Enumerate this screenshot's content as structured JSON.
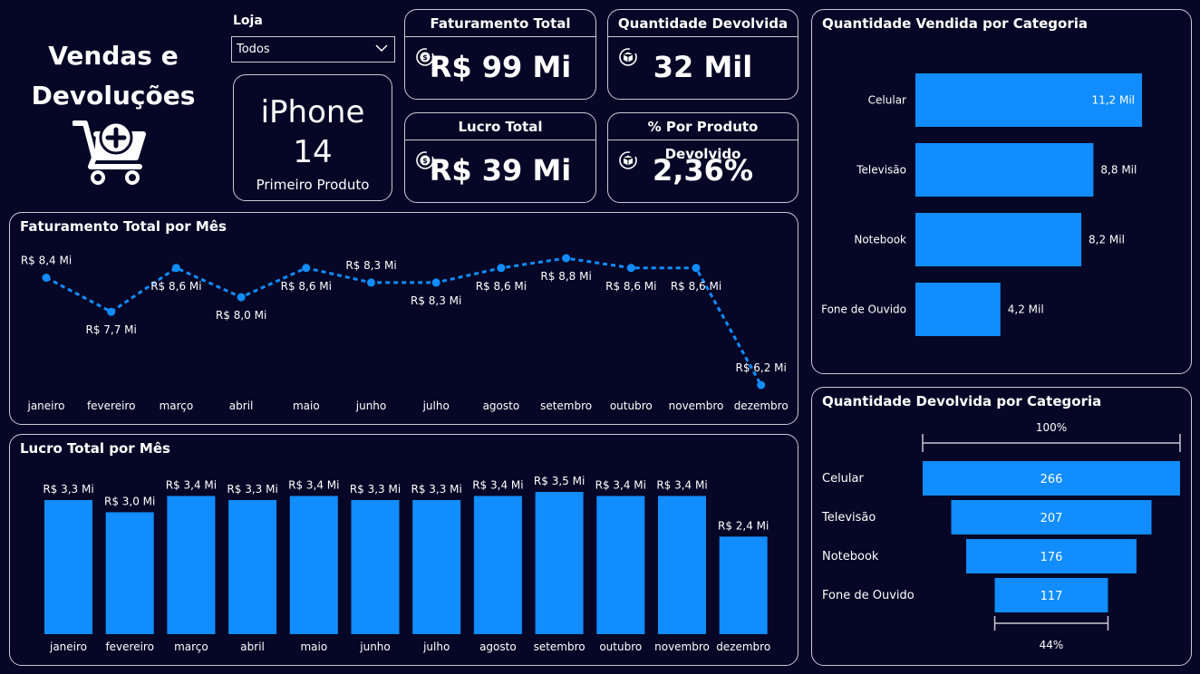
{
  "header": {
    "title_line1": "Vendas e",
    "title_line2": "Devoluções"
  },
  "filter": {
    "label": "Loja",
    "selected": "Todos"
  },
  "product_card": {
    "line1": "iPhone",
    "line2": "14",
    "caption": "Primeiro Produto"
  },
  "kpis": {
    "faturamento": {
      "title": "Faturamento Total",
      "value": "R$ 99 Mi"
    },
    "devolvida": {
      "title": "Quantidade Devolvida",
      "value": "32 Mil"
    },
    "lucro": {
      "title": "Lucro Total",
      "value": "R$ 39 Mi"
    },
    "pct": {
      "title": "% Por Produto Devolvido",
      "value": "2,36%"
    }
  },
  "colors": {
    "background": "#060626",
    "accent": "#118dff",
    "border": "#c9c9d6",
    "text": "#ffffff"
  },
  "icons": {
    "cart": "shopping-cart-plus-icon",
    "money": "money-cycle-icon",
    "box": "box-return-icon",
    "dropdown": "chevron-down-icon"
  },
  "chart_data": [
    {
      "id": "faturamento_mes",
      "type": "line",
      "title": "Faturamento Total por Mês",
      "categories": [
        "janeiro",
        "fevereiro",
        "março",
        "abril",
        "maio",
        "junho",
        "julho",
        "agosto",
        "setembro",
        "outubro",
        "novembro",
        "dezembro"
      ],
      "values": [
        8.4,
        7.7,
        8.6,
        8.0,
        8.6,
        8.3,
        8.3,
        8.6,
        8.8,
        8.6,
        8.6,
        6.2
      ],
      "labels": [
        "R$ 8,4 Mi",
        "R$ 7,7 Mi",
        "R$ 8,6 Mi",
        "R$ 8,0 Mi",
        "R$ 8,6 Mi",
        "R$ 8,3 Mi",
        "R$ 8,3 Mi",
        "R$ 8,6 Mi",
        "R$ 8,8 Mi",
        "R$ 8,6 Mi",
        "R$ 8,6 Mi",
        "R$ 6,2 Mi"
      ],
      "label_pos": [
        "above",
        "below",
        "below",
        "below",
        "below",
        "above",
        "below",
        "below",
        "below",
        "below",
        "below",
        "above"
      ],
      "ylim": [
        6.2,
        8.8
      ],
      "line_style": "dashed"
    },
    {
      "id": "lucro_mes",
      "type": "bar",
      "title": "Lucro Total por Mês",
      "categories": [
        "janeiro",
        "fevereiro",
        "março",
        "abril",
        "maio",
        "junho",
        "julho",
        "agosto",
        "setembro",
        "outubro",
        "novembro",
        "dezembro"
      ],
      "values": [
        3.3,
        3.0,
        3.4,
        3.3,
        3.4,
        3.3,
        3.3,
        3.4,
        3.5,
        3.4,
        3.4,
        2.4
      ],
      "labels": [
        "R$ 3,3 Mi",
        "R$ 3,0 Mi",
        "R$ 3,4 Mi",
        "R$ 3,3 Mi",
        "R$ 3,4 Mi",
        "R$ 3,3 Mi",
        "R$ 3,3 Mi",
        "R$ 3,4 Mi",
        "R$ 3,5 Mi",
        "R$ 3,4 Mi",
        "R$ 3,4 Mi",
        "R$ 2,4 Mi"
      ],
      "ylim": [
        0,
        3.5
      ]
    },
    {
      "id": "vendida_categoria",
      "type": "bar",
      "orientation": "horizontal",
      "title": "Quantidade Vendida por Categoria",
      "categories": [
        "Celular",
        "Televisão",
        "Notebook",
        "Fone de Ouvido"
      ],
      "values": [
        11.2,
        8.8,
        8.2,
        4.2
      ],
      "labels": [
        "11,2 Mil",
        "8,8 Mil",
        "8,2 Mil",
        "4,2 Mil"
      ],
      "xlim": [
        0,
        11.2
      ]
    },
    {
      "id": "devolvida_categoria",
      "type": "funnel",
      "title": "Quantidade Devolvida por Categoria",
      "categories": [
        "Celular",
        "Televisão",
        "Notebook",
        "Fone de Ouvido"
      ],
      "values": [
        266,
        207,
        176,
        117
      ],
      "labels": [
        "266",
        "207",
        "176",
        "117"
      ],
      "top_pct": "100%",
      "bottom_pct": "44%"
    }
  ]
}
